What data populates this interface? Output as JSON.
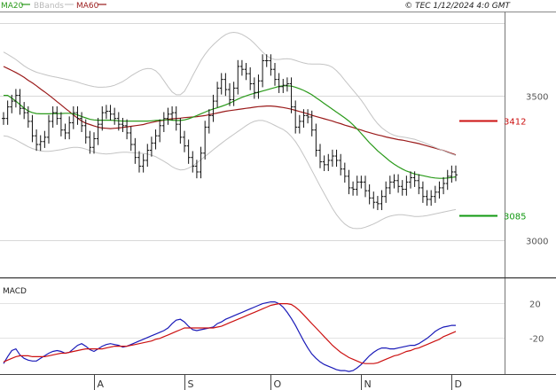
{
  "header": {
    "legend": [
      {
        "label": "MA20",
        "color": "#2a9a1a"
      },
      {
        "label": "BBands",
        "color": "#bdbdbd"
      },
      {
        "label": "MA60",
        "color": "#9a1a1a"
      }
    ],
    "timestamp": "© TEC 1/12/2024 4:0 GMT"
  },
  "chart_data": [
    {
      "type": "line",
      "panel": "price",
      "title": "",
      "xlabel": "",
      "ylabel": "",
      "ylim": [
        2870,
        3790
      ],
      "yticks": [
        {
          "value": 3000,
          "label": "3000"
        },
        {
          "value": 3500,
          "label": "3500"
        }
      ],
      "x_categories": [
        "A",
        "S",
        "O",
        "N",
        "D"
      ],
      "x_category_index": [
        22,
        44,
        65,
        87,
        109
      ],
      "levels": [
        {
          "label": "3412",
          "value": 3412,
          "color": "#cc1111"
        },
        {
          "label": "3085",
          "value": 3085,
          "color": "#119911"
        }
      ],
      "series": [
        {
          "name": "MA60",
          "color": "#9a1a1a",
          "values": [
            3600,
            3593,
            3586,
            3579,
            3571,
            3562,
            3552,
            3543,
            3533,
            3522,
            3512,
            3501,
            3490,
            3478,
            3467,
            3455,
            3444,
            3432,
            3421,
            3411,
            3404,
            3399,
            3394,
            3390,
            3387,
            3386,
            3385,
            3386,
            3387,
            3389,
            3391,
            3393,
            3395,
            3397,
            3399,
            3403,
            3406,
            3409,
            3412,
            3414,
            3417,
            3419,
            3420,
            3421,
            3423,
            3424,
            3425,
            3426,
            3428,
            3430,
            3433,
            3436,
            3439,
            3442,
            3445,
            3447,
            3449,
            3451,
            3453,
            3455,
            3457,
            3459,
            3461,
            3462,
            3463,
            3463,
            3462,
            3460,
            3458,
            3455,
            3452,
            3448,
            3444,
            3440,
            3436,
            3431,
            3427,
            3423,
            3419,
            3415,
            3411,
            3406,
            3402,
            3397,
            3393,
            3389,
            3384,
            3380,
            3375,
            3371,
            3367,
            3363,
            3360,
            3356,
            3353,
            3350,
            3347,
            3345,
            3342,
            3339,
            3336,
            3333,
            3329,
            3325,
            3321,
            3317,
            3313,
            3309,
            3304,
            3299,
            3294
          ]
        },
        {
          "name": "MA20",
          "color": "#2a9a1a",
          "values": [
            3500,
            3500,
            3490,
            3480,
            3468,
            3456,
            3446,
            3440,
            3437,
            3436,
            3436,
            3436,
            3437,
            3437,
            3437,
            3438,
            3438,
            3436,
            3432,
            3427,
            3422,
            3417,
            3415,
            3414,
            3414,
            3414,
            3414,
            3413,
            3412,
            3411,
            3411,
            3411,
            3411,
            3411,
            3411,
            3411,
            3412,
            3413,
            3414,
            3415,
            3415,
            3414,
            3413,
            3413,
            3415,
            3419,
            3424,
            3430,
            3436,
            3442,
            3448,
            3453,
            3457,
            3462,
            3467,
            3473,
            3480,
            3487,
            3493,
            3498,
            3503,
            3507,
            3511,
            3515,
            3519,
            3523,
            3527,
            3531,
            3533,
            3533,
            3532,
            3528,
            3523,
            3517,
            3510,
            3502,
            3492,
            3482,
            3472,
            3462,
            3452,
            3442,
            3432,
            3422,
            3411,
            3398,
            3384,
            3368,
            3352,
            3336,
            3322,
            3308,
            3296,
            3284,
            3272,
            3262,
            3253,
            3245,
            3238,
            3233,
            3228,
            3225,
            3222,
            3219,
            3216,
            3214,
            3213,
            3213,
            3214,
            3216,
            3218
          ]
        },
        {
          "name": "BBands upper",
          "color": "#c4c4c4",
          "values": [
            3650,
            3642,
            3633,
            3624,
            3613,
            3602,
            3593,
            3586,
            3580,
            3576,
            3572,
            3568,
            3565,
            3562,
            3559,
            3556,
            3553,
            3550,
            3546,
            3541,
            3537,
            3533,
            3530,
            3528,
            3528,
            3529,
            3531,
            3535,
            3541,
            3548,
            3557,
            3567,
            3576,
            3584,
            3590,
            3593,
            3592,
            3585,
            3571,
            3551,
            3530,
            3512,
            3502,
            3502,
            3514,
            3539,
            3568,
            3594,
            3620,
            3642,
            3660,
            3675,
            3688,
            3700,
            3710,
            3716,
            3718,
            3716,
            3711,
            3703,
            3693,
            3680,
            3665,
            3650,
            3637,
            3628,
            3624,
            3624,
            3626,
            3627,
            3625,
            3621,
            3616,
            3612,
            3609,
            3608,
            3608,
            3608,
            3607,
            3604,
            3597,
            3585,
            3570,
            3552,
            3535,
            3518,
            3501,
            3483,
            3463,
            3441,
            3420,
            3402,
            3388,
            3377,
            3368,
            3362,
            3358,
            3356,
            3354,
            3351,
            3348,
            3343,
            3338,
            3332,
            3326,
            3320,
            3314,
            3308,
            3302,
            3297,
            3292
          ]
        },
        {
          "name": "BBands lower",
          "color": "#c4c4c4",
          "values": [
            3360,
            3358,
            3352,
            3346,
            3338,
            3330,
            3322,
            3316,
            3312,
            3308,
            3306,
            3306,
            3308,
            3310,
            3312,
            3315,
            3318,
            3320,
            3320,
            3318,
            3314,
            3309,
            3304,
            3300,
            3298,
            3297,
            3298,
            3300,
            3302,
            3303,
            3303,
            3302,
            3301,
            3300,
            3299,
            3297,
            3293,
            3288,
            3280,
            3272,
            3263,
            3253,
            3246,
            3242,
            3243,
            3248,
            3256,
            3266,
            3277,
            3289,
            3300,
            3312,
            3323,
            3334,
            3345,
            3355,
            3365,
            3375,
            3385,
            3395,
            3404,
            3410,
            3413,
            3413,
            3409,
            3403,
            3396,
            3389,
            3382,
            3372,
            3358,
            3340,
            3318,
            3293,
            3267,
            3240,
            3213,
            3186,
            3160,
            3134,
            3109,
            3087,
            3069,
            3055,
            3045,
            3040,
            3039,
            3040,
            3044,
            3049,
            3055,
            3062,
            3070,
            3077,
            3082,
            3085,
            3087,
            3087,
            3085,
            3083,
            3081,
            3081,
            3082,
            3084,
            3087,
            3090,
            3093,
            3096,
            3099,
            3102,
            3105
          ]
        },
        {
          "name": "Price",
          "type": "ohlc",
          "color": "#111111",
          "values": [
            3420,
            3460,
            3480,
            3500,
            3455,
            3440,
            3410,
            3360,
            3330,
            3340,
            3355,
            3410,
            3440,
            3420,
            3380,
            3370,
            3405,
            3440,
            3420,
            3395,
            3355,
            3320,
            3350,
            3400,
            3440,
            3445,
            3435,
            3420,
            3400,
            3395,
            3370,
            3330,
            3285,
            3255,
            3275,
            3310,
            3335,
            3360,
            3395,
            3420,
            3435,
            3440,
            3400,
            3355,
            3325,
            3285,
            3255,
            3235,
            3300,
            3390,
            3430,
            3480,
            3525,
            3555,
            3520,
            3485,
            3525,
            3600,
            3590,
            3575,
            3540,
            3510,
            3550,
            3620,
            3620,
            3590,
            3555,
            3530,
            3535,
            3540,
            3460,
            3390,
            3410,
            3430,
            3425,
            3380,
            3310,
            3270,
            3260,
            3275,
            3290,
            3275,
            3245,
            3220,
            3180,
            3175,
            3200,
            3200,
            3170,
            3145,
            3130,
            3125,
            3150,
            3180,
            3200,
            3205,
            3185,
            3175,
            3200,
            3215,
            3205,
            3180,
            3150,
            3140,
            3150,
            3165,
            3180,
            3195,
            3220,
            3235,
            3225
          ]
        }
      ]
    },
    {
      "type": "line",
      "panel": "macd",
      "title": "MACD",
      "xlabel": "",
      "ylabel": "",
      "ylim": [
        -62,
        42
      ],
      "yticks": [
        {
          "value": 20,
          "label": "20"
        },
        {
          "value": -20,
          "label": "-20"
        }
      ],
      "series": [
        {
          "name": "MACD",
          "color": "#1a1ab8",
          "values": [
            -50,
            -42,
            -35,
            -33,
            -40,
            -44,
            -46,
            -47,
            -47,
            -44,
            -41,
            -38,
            -36,
            -35,
            -36,
            -38,
            -37,
            -33,
            -29,
            -27,
            -30,
            -34,
            -36,
            -33,
            -30,
            -28,
            -27,
            -28,
            -29,
            -31,
            -30,
            -28,
            -26,
            -24,
            -22,
            -20,
            -18,
            -16,
            -14,
            -12,
            -9,
            -4,
            0,
            1,
            -2,
            -7,
            -11,
            -12,
            -11,
            -10,
            -9,
            -8,
            -4,
            -2,
            1,
            3,
            5,
            7,
            9,
            11,
            13,
            15,
            17,
            19,
            20,
            21,
            21,
            19,
            15,
            9,
            2,
            -6,
            -15,
            -24,
            -32,
            -39,
            -44,
            -48,
            -51,
            -53,
            -55,
            -57,
            -58,
            -58,
            -59,
            -58,
            -55,
            -51,
            -46,
            -41,
            -37,
            -34,
            -32,
            -32,
            -33,
            -33,
            -32,
            -31,
            -30,
            -29,
            -29,
            -27,
            -24,
            -21,
            -17,
            -13,
            -10,
            -8,
            -7,
            -6,
            -6
          ]
        },
        {
          "name": "Signal",
          "color": "#cc1111",
          "values": [
            -48,
            -46,
            -44,
            -42,
            -41,
            -41,
            -41,
            -42,
            -42,
            -42,
            -42,
            -41,
            -40,
            -39,
            -38,
            -38,
            -37,
            -36,
            -35,
            -34,
            -33,
            -33,
            -33,
            -33,
            -33,
            -32,
            -31,
            -30,
            -30,
            -30,
            -30,
            -29,
            -28,
            -27,
            -26,
            -25,
            -24,
            -22,
            -21,
            -19,
            -17,
            -15,
            -13,
            -11,
            -9,
            -9,
            -9,
            -9,
            -9,
            -9,
            -9,
            -9,
            -8,
            -7,
            -5,
            -3,
            -1,
            1,
            3,
            5,
            7,
            9,
            11,
            13,
            15,
            17,
            18,
            19,
            19,
            19,
            18,
            15,
            11,
            6,
            1,
            -4,
            -9,
            -14,
            -19,
            -24,
            -29,
            -33,
            -37,
            -40,
            -43,
            -45,
            -47,
            -49,
            -50,
            -50,
            -50,
            -49,
            -47,
            -45,
            -43,
            -41,
            -40,
            -38,
            -36,
            -35,
            -33,
            -32,
            -30,
            -28,
            -26,
            -24,
            -22,
            -19,
            -17,
            -15,
            -13
          ]
        }
      ]
    }
  ]
}
